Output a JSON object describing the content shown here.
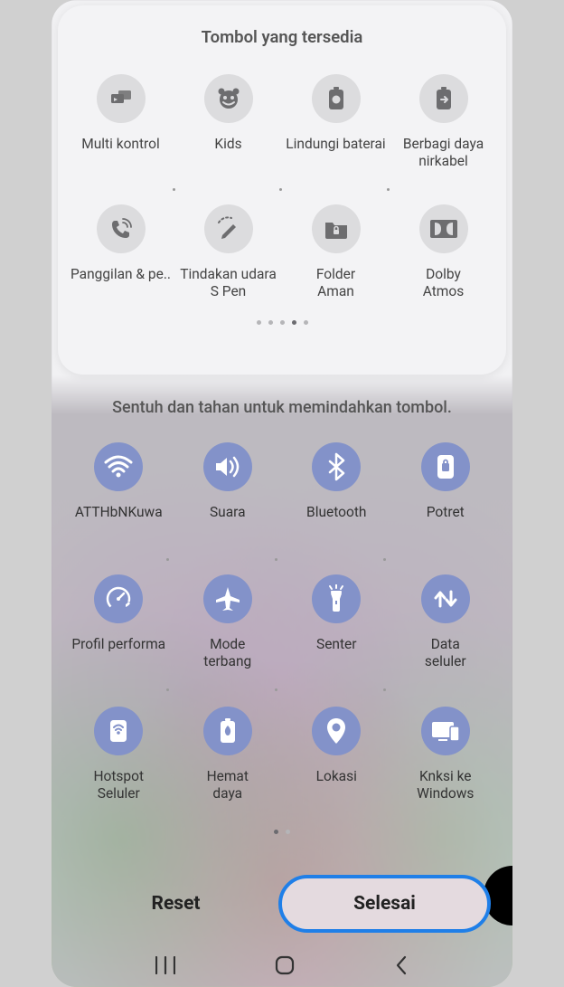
{
  "available": {
    "title": "Tombol yang tersedia",
    "tiles": [
      {
        "name": "multi-control",
        "label": "Multi kontrol",
        "icon": "multi-control"
      },
      {
        "name": "kids",
        "label": "Kids",
        "icon": "kids"
      },
      {
        "name": "protect-battery",
        "label": "Lindungi baterai",
        "icon": "protect-battery"
      },
      {
        "name": "wireless-powershare",
        "label": "Berbagi daya\nnirkabel",
        "icon": "wireless-powershare"
      },
      {
        "name": "call-message",
        "label": "Panggilan & pe..",
        "icon": "call-message"
      },
      {
        "name": "spen-air",
        "label": "Tindakan udara\nS Pen",
        "icon": "spen-air"
      },
      {
        "name": "secure-folder",
        "label": "Folder\nAman",
        "icon": "secure-folder"
      },
      {
        "name": "dolby-atmos",
        "label": "Dolby\nAtmos",
        "icon": "dolby-atmos"
      }
    ],
    "page_count": 5,
    "page_active": 3
  },
  "active": {
    "instruction": "Sentuh dan tahan untuk memindahkan tombol.",
    "tiles": [
      {
        "name": "wifi",
        "label": "ATTHbNKuwa",
        "icon": "wifi"
      },
      {
        "name": "sound",
        "label": "Suara",
        "icon": "sound"
      },
      {
        "name": "bluetooth",
        "label": "Bluetooth",
        "icon": "bluetooth"
      },
      {
        "name": "portrait",
        "label": "Potret",
        "icon": "portrait"
      },
      {
        "name": "performance",
        "label": "Profil performa",
        "icon": "performance"
      },
      {
        "name": "airplane",
        "label": "Mode\nterbang",
        "icon": "airplane"
      },
      {
        "name": "flashlight",
        "label": "Senter",
        "icon": "flashlight"
      },
      {
        "name": "mobile-data",
        "label": "Data\nseluler",
        "icon": "mobile-data"
      },
      {
        "name": "hotspot",
        "label": "Hotspot\nSeluler",
        "icon": "hotspot"
      },
      {
        "name": "power-saving",
        "label": "Hemat\ndaya",
        "icon": "power-saving"
      },
      {
        "name": "location",
        "label": "Lokasi",
        "icon": "location"
      },
      {
        "name": "link-windows",
        "label": "Knksi ke\nWindows",
        "icon": "link-windows"
      }
    ],
    "page_count": 2,
    "page_active": 0
  },
  "buttons": {
    "reset": "Reset",
    "done": "Selesai"
  },
  "icon_fill_gray": "#6d6d6f",
  "icon_fill_white": "#ffffff"
}
